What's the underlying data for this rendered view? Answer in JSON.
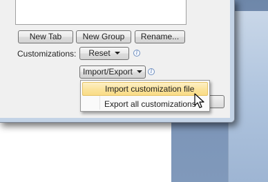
{
  "buttons": {
    "new_tab": "New Tab",
    "new_group": "New Group",
    "rename": "Rename...",
    "reset": "Reset",
    "import_export": "Import/Export"
  },
  "labels": {
    "customizations": "Customizations:"
  },
  "menu": {
    "items": [
      "Import customization file",
      "Export all customizations"
    ]
  },
  "icons": {
    "info": "info-icon",
    "dropdown": "chevron-down-icon",
    "cursor": "mouse-pointer-icon"
  },
  "colors": {
    "highlight": "#fbe39b",
    "background_window": "#7a93b6",
    "dialog": "#f0f0f0"
  }
}
